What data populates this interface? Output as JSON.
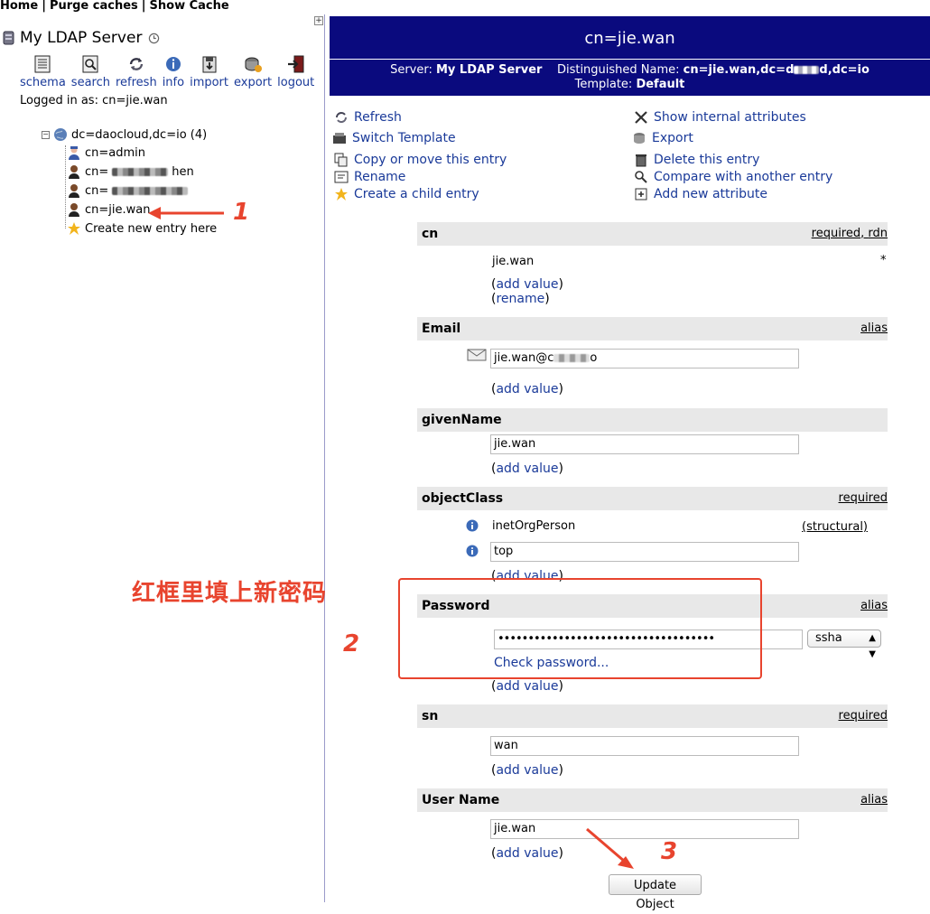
{
  "topbar": {
    "home": "Home",
    "purge": "Purge caches",
    "show_cache": "Show Cache"
  },
  "left": {
    "expand": "+",
    "server_name": "My LDAP Server",
    "toolbar": [
      {
        "label": "schema",
        "icon": "schema-icon"
      },
      {
        "label": "search",
        "icon": "search-icon"
      },
      {
        "label": "refresh",
        "icon": "refresh-icon"
      },
      {
        "label": "info",
        "icon": "info-icon"
      },
      {
        "label": "import",
        "icon": "import-icon"
      },
      {
        "label": "export",
        "icon": "export-icon"
      },
      {
        "label": "logout",
        "icon": "logout-icon"
      }
    ],
    "logged_in": "Logged in as: cn=jie.wan",
    "tree": {
      "root": "dc=daocloud,dc=io (4)",
      "children": [
        "cn=admin",
        "cn=",
        "cn=",
        "cn=jie.wan"
      ],
      "child_suffix_2": "hen",
      "create": "Create new entry here"
    }
  },
  "annotations": {
    "n1": "1",
    "n2": "2",
    "n3": "3",
    "hint": "红框里填上新密码"
  },
  "header": {
    "title": "cn=jie.wan",
    "server_label": "Server:",
    "server_value": "My LDAP Server",
    "dn_label": "Distinguished Name:",
    "dn_value": "cn=jie.wan,dc=d",
    "dn_tail": "d,dc=io",
    "template_label": "Template:",
    "template_value": "Default"
  },
  "actions_left": [
    "Refresh",
    "Switch Template",
    "Copy or move this entry",
    "Rename",
    "Create a child entry"
  ],
  "actions_right": [
    "Show internal attributes",
    "Export",
    "Delete this entry",
    "Compare with another entry",
    "Add new attribute"
  ],
  "attributes": {
    "cn": {
      "name": "cn",
      "flags_a": "required",
      "flags_b": "rdn",
      "value": "jie.wan",
      "star": "*",
      "add": "add value",
      "rename": "rename"
    },
    "email": {
      "name": "Email",
      "flag": "alias",
      "value_prefix": "jie.wan@c",
      "value_suffix": "o",
      "add": "add value"
    },
    "givenName": {
      "name": "givenName",
      "value": "jie.wan",
      "add": "add value"
    },
    "objectClass": {
      "name": "objectClass",
      "flag": "required",
      "value1": "inetOrgPerson",
      "structural": "(structural)",
      "value2": "top",
      "add": "add value"
    },
    "password": {
      "name": "Password",
      "flag": "alias",
      "value": "••••••••••••••••••••••••••••••••••••",
      "encoding": "ssha",
      "check": "Check password...",
      "add": "add value"
    },
    "sn": {
      "name": "sn",
      "flag": "required",
      "value": "wan",
      "add": "add value"
    },
    "userName": {
      "name": "User Name",
      "flag": "alias",
      "value": "jie.wan",
      "add": "add value"
    }
  },
  "update_button": "Update Object",
  "colors": {
    "header_bg": "#0a0a7e",
    "annotation": "#e8442e",
    "link": "#1a3a99"
  }
}
